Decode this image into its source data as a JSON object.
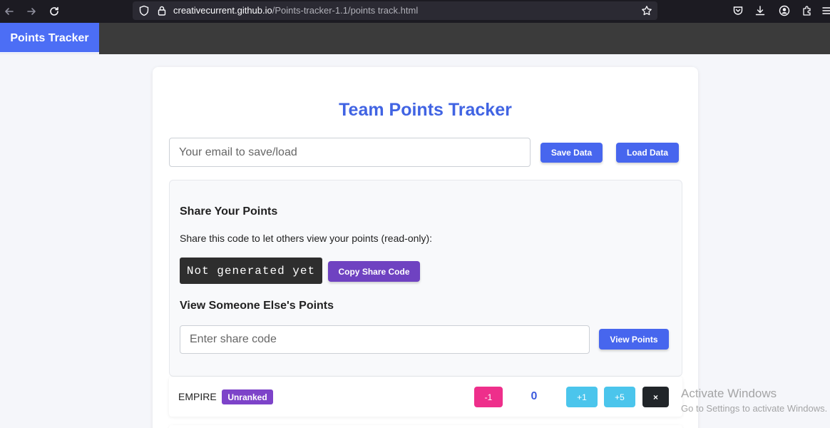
{
  "browser": {
    "url_host": "creativecurrent.github.io",
    "url_path": "/Points-tracker-1.1/points track.html"
  },
  "navbar": {
    "brand": "Points Tracker"
  },
  "main": {
    "title": "Team Points Tracker",
    "email_placeholder": "Your email to save/load",
    "save_label": "Save Data",
    "load_label": "Load Data"
  },
  "share": {
    "heading": "Share Your Points",
    "description": "Share this code to let others view your points (read-only):",
    "code": "Not generated yet",
    "copy_label": "Copy Share Code",
    "view_heading": "View Someone Else's Points",
    "input_placeholder": "Enter share code",
    "view_label": "View Points"
  },
  "teams": [
    {
      "name": "EMPIRE",
      "rank": "Unranked",
      "points": "0",
      "minus_label": "-1",
      "plus1_label": "+1",
      "plus5_label": "+5",
      "delete_label": "×"
    }
  ],
  "watermark": {
    "title": "Activate Windows",
    "subtitle": "Go to Settings to activate Windows."
  },
  "colors": {
    "brand_blue": "#4c6ef5",
    "primary_blue": "#4766ee",
    "title_blue": "#4164e3",
    "purple": "#6f42c1",
    "pink": "#ee2f8b",
    "cyan": "#4bc5ec",
    "dark": "#212529"
  },
  "icons": [
    "back-arrow-icon",
    "forward-arrow-icon",
    "reload-icon",
    "shield-icon",
    "lock-icon",
    "star-icon",
    "pocket-icon",
    "download-icon",
    "account-icon",
    "extensions-icon",
    "menu-icon"
  ]
}
